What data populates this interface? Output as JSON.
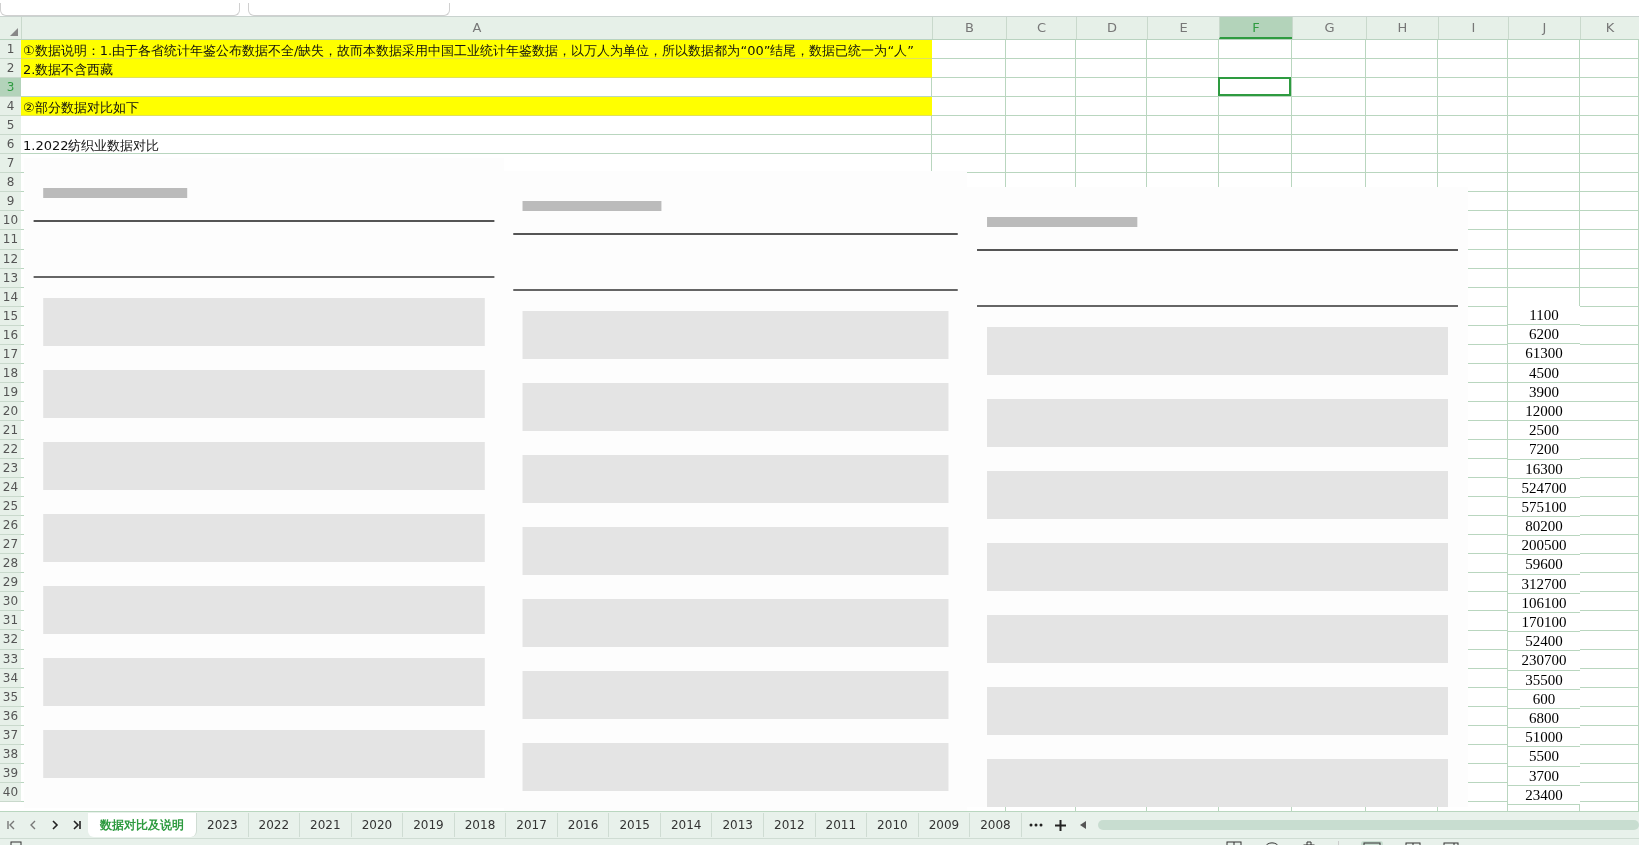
{
  "column_headers": [
    {
      "label": "A",
      "selected": false
    },
    {
      "label": "B",
      "selected": false
    },
    {
      "label": "C",
      "selected": false
    },
    {
      "label": "D",
      "selected": false
    },
    {
      "label": "E",
      "selected": false
    },
    {
      "label": "F",
      "selected": true
    },
    {
      "label": "G",
      "selected": false
    },
    {
      "label": "H",
      "selected": false
    },
    {
      "label": "I",
      "selected": false
    },
    {
      "label": "J",
      "selected": false
    },
    {
      "label": "K",
      "selected": false
    }
  ],
  "row_numbers": [
    {
      "label": "1",
      "selected": false
    },
    {
      "label": "2",
      "selected": false
    },
    {
      "label": "3",
      "selected": true
    },
    {
      "label": "4",
      "selected": false
    },
    {
      "label": "5",
      "selected": false
    },
    {
      "label": "6",
      "selected": false
    },
    {
      "label": "7",
      "selected": false
    },
    {
      "label": "8",
      "selected": false
    },
    {
      "label": "9",
      "selected": false
    },
    {
      "label": "10",
      "selected": false
    },
    {
      "label": "11",
      "selected": false
    },
    {
      "label": "12",
      "selected": false
    },
    {
      "label": "13",
      "selected": false
    },
    {
      "label": "14",
      "selected": false
    },
    {
      "label": "15",
      "selected": false
    },
    {
      "label": "16",
      "selected": false
    },
    {
      "label": "17",
      "selected": false
    },
    {
      "label": "18",
      "selected": false
    },
    {
      "label": "19",
      "selected": false
    },
    {
      "label": "20",
      "selected": false
    },
    {
      "label": "21",
      "selected": false
    },
    {
      "label": "22",
      "selected": false
    },
    {
      "label": "23",
      "selected": false
    },
    {
      "label": "24",
      "selected": false
    },
    {
      "label": "25",
      "selected": false
    },
    {
      "label": "26",
      "selected": false
    },
    {
      "label": "27",
      "selected": false
    },
    {
      "label": "28",
      "selected": false
    },
    {
      "label": "29",
      "selected": false
    },
    {
      "label": "30",
      "selected": false
    },
    {
      "label": "31",
      "selected": false
    },
    {
      "label": "32",
      "selected": false
    },
    {
      "label": "33",
      "selected": false
    },
    {
      "label": "34",
      "selected": false
    },
    {
      "label": "35",
      "selected": false
    },
    {
      "label": "36",
      "selected": false
    },
    {
      "label": "37",
      "selected": false
    },
    {
      "label": "38",
      "selected": false
    },
    {
      "label": "39",
      "selected": false
    },
    {
      "label": "40",
      "selected": false
    }
  ],
  "a_column": [
    {
      "text": "①数据说明：1.由于各省统计年鉴公布数据不全/缺失，故而本数据采用中国工业统计年鉴数据，以万人为单位，所以数据都为“00”结尾，数据已统一为“人”",
      "highlighted": true
    },
    {
      "text": "2.数据不含西藏",
      "highlighted": true
    },
    {
      "highlighted": false
    },
    {
      "text": "②部分数据对比如下",
      "highlighted": true
    },
    {
      "highlighted": false
    },
    {
      "text": "1.2022纺织业数据对比",
      "highlighted": false
    }
  ],
  "j_values": [
    "1100",
    "6200",
    "61300",
    "4500",
    "3900",
    "12000",
    "2500",
    "7200",
    "16300",
    "524700",
    "575100",
    "80200",
    "200500",
    "59600",
    "312700",
    "106100",
    "170100",
    "52400",
    "230700",
    "35500",
    "600",
    "6800",
    "51000",
    "5500",
    "3700",
    "23400"
  ],
  "sheet_tabs": [
    {
      "label": "数据对比及说明",
      "selected": true
    },
    {
      "label": "2023",
      "selected": false
    },
    {
      "label": "2022",
      "selected": false
    },
    {
      "label": "2021",
      "selected": false
    },
    {
      "label": "2020",
      "selected": false
    },
    {
      "label": "2019",
      "selected": false
    },
    {
      "label": "2018",
      "selected": false
    },
    {
      "label": "2017",
      "selected": false
    },
    {
      "label": "2016",
      "selected": false
    },
    {
      "label": "2015",
      "selected": false
    },
    {
      "label": "2014",
      "selected": false
    },
    {
      "label": "2013",
      "selected": false
    },
    {
      "label": "2012",
      "selected": false
    },
    {
      "label": "2011",
      "selected": false
    },
    {
      "label": "2010",
      "selected": false
    },
    {
      "label": "2009",
      "selected": false
    },
    {
      "label": "2008",
      "selected": false
    }
  ]
}
